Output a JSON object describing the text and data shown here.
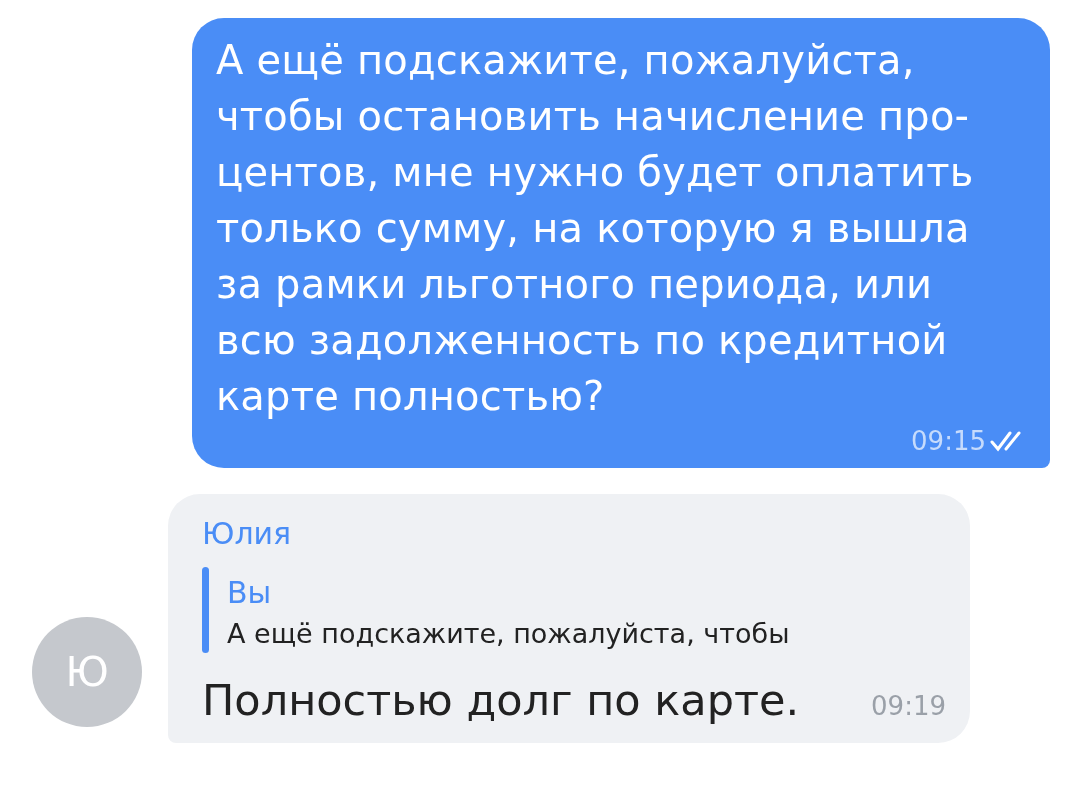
{
  "messages": [
    {
      "kind": "outgoing",
      "text": "А ещё подскажите, пожалуйста,\nчтобы остановить начисление про-\nцентов, мне нужно будет оплатить\nтолько сумму, на которую я вышла\nза рамки льготного периода, или\nвсю задолженность по кредитной\nкарте полностью?",
      "time": "09:15",
      "read": true
    },
    {
      "kind": "incoming",
      "avatar": "Ю",
      "sender": "Юлия",
      "reply": {
        "author": "Вы",
        "text": "А ещё подскажите, пожалуйста, чтобы"
      },
      "text": "Полностью долг по карте.",
      "time": "09:19"
    }
  ]
}
